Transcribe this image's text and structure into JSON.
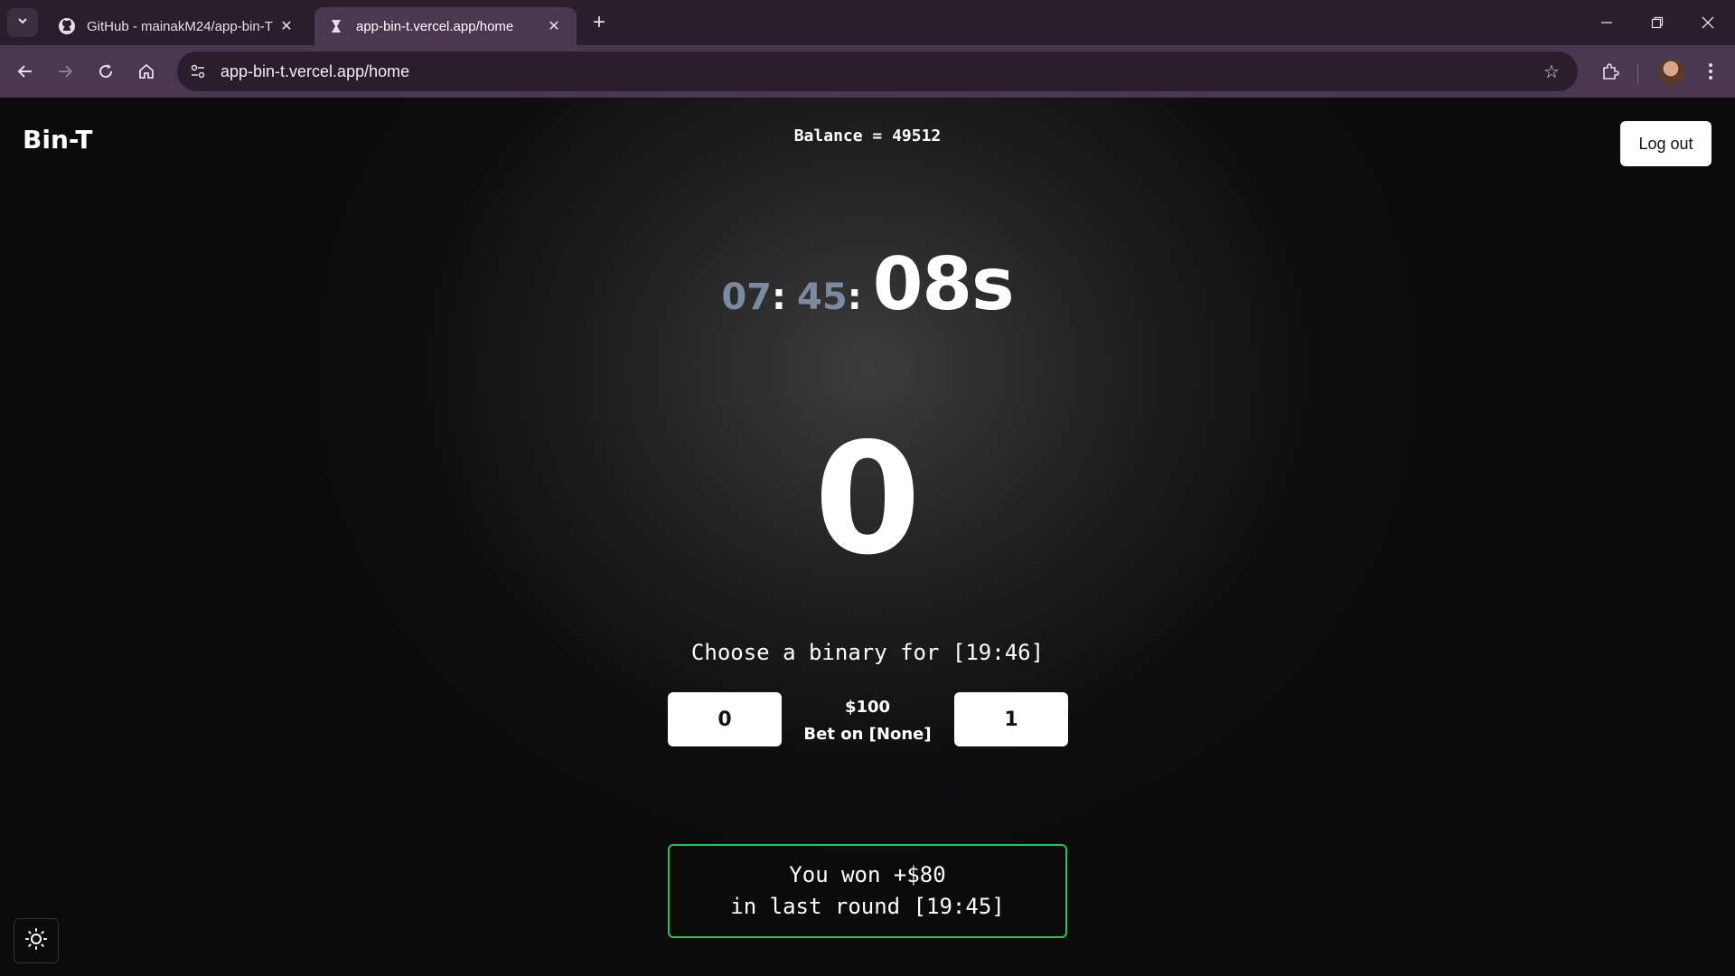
{
  "browser": {
    "tabs": [
      {
        "title": "GitHub - mainakM24/app-bin-T",
        "icon": "github-icon"
      },
      {
        "title": "app-bin-t.vercel.app/home",
        "icon": "vercel-icon"
      }
    ],
    "url": "app-bin-t.vercel.app/home"
  },
  "header": {
    "brand": "Bin-T",
    "balance": "Balance = 49512",
    "logout_label": "Log out"
  },
  "timer": {
    "hours": "07",
    "minutes": "45",
    "seconds": "08s"
  },
  "current_binary": "0",
  "bet": {
    "prompt": "Choose a binary for [19:46]",
    "option_zero": "0",
    "option_one": "1",
    "amount": "$100",
    "selection": "Bet on [None]"
  },
  "result": {
    "line1": "You won +$80",
    "line2": "in last round [19:45]",
    "accent_color": "#22c55e"
  },
  "theme_toggle_icon": "sun-icon"
}
